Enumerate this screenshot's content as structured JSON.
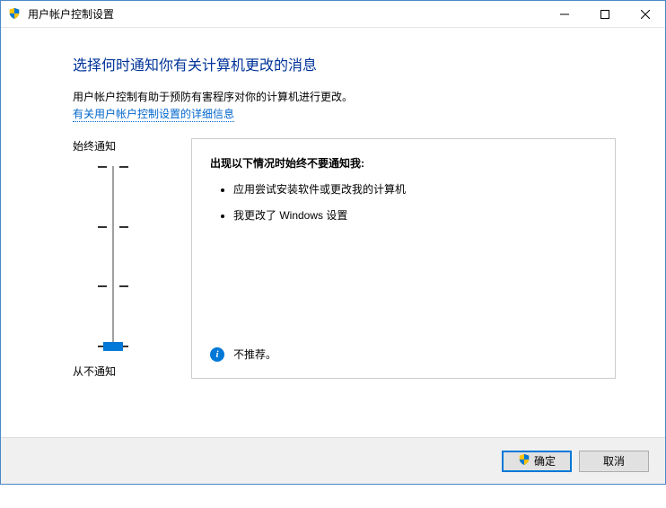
{
  "titlebar": {
    "title": "用户帐户控制设置"
  },
  "page": {
    "heading": "选择何时通知你有关计算机更改的消息",
    "description": "用户帐户控制有助于预防有害程序对你的计算机进行更改。",
    "link": "有关用户帐户控制设置的详细信息"
  },
  "slider": {
    "top_label": "始终通知",
    "bottom_label": "从不通知",
    "levels": 4,
    "value": 0
  },
  "info": {
    "heading": "出现以下情况时始终不要通知我:",
    "items": [
      "应用尝试安装软件或更改我的计算机",
      "我更改了 Windows 设置"
    ],
    "recommendation": "不推荐。"
  },
  "buttons": {
    "ok": "确定",
    "cancel": "取消"
  }
}
